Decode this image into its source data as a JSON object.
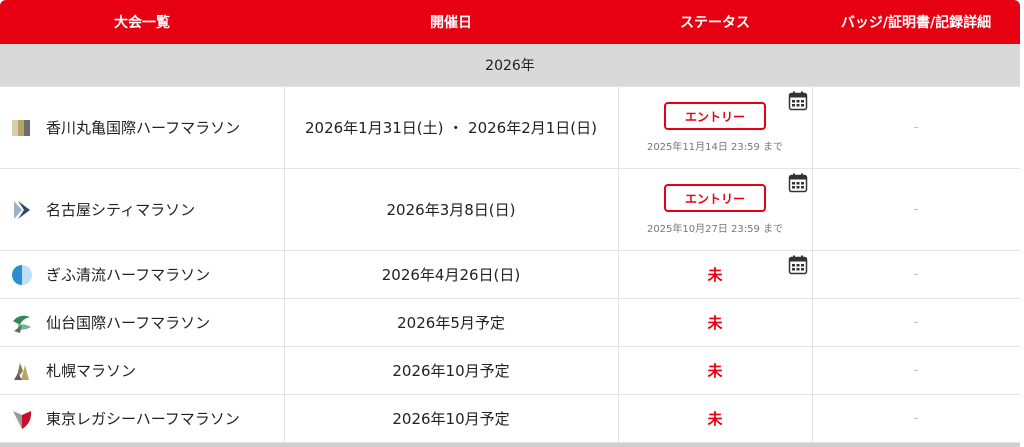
{
  "headers": {
    "competitions": "大会一覧",
    "date": "開催日",
    "status": "ステータス",
    "badges": "バッジ/証明書/記録詳細"
  },
  "year_label": "2026年",
  "rows": [
    {
      "name": "香川丸亀国際ハーフマラソン",
      "date": "2026年1月31日(土) ・ 2026年2月1日(日)",
      "entry": "エントリー",
      "deadline": "2025年11月14日 23:59 まで",
      "status": "",
      "badge": "-",
      "logo_color": "#b8a46a"
    },
    {
      "name": "名古屋シティマラソン",
      "date": "2026年3月8日(日)",
      "entry": "エントリー",
      "deadline": "2025年10月27日 23:59 まで",
      "status": "",
      "badge": "-",
      "logo_color": "#2b4a6b"
    },
    {
      "name": "ぎふ清流ハーフマラソン",
      "date": "2026年4月26日(日)",
      "entry": "",
      "deadline": "",
      "status": "未",
      "badge": "-",
      "logo_color": "#2a8fd0"
    },
    {
      "name": "仙台国際ハーフマラソン",
      "date": "2026年5月予定",
      "entry": "",
      "deadline": "",
      "status": "未",
      "badge": "-",
      "logo_color": "#2e8b57"
    },
    {
      "name": "札幌マラソン",
      "date": "2026年10月予定",
      "entry": "",
      "deadline": "",
      "status": "未",
      "badge": "-",
      "logo_color": "#8c7b4a"
    },
    {
      "name": "東京レガシーハーフマラソン",
      "date": "2026年10月予定",
      "entry": "",
      "deadline": "",
      "status": "未",
      "badge": "-",
      "logo_color": "#c8102e"
    }
  ],
  "calendar_icon": "calendar-icon",
  "colors": {
    "accent": "#e60012",
    "year_bg": "#d9d9d9"
  }
}
